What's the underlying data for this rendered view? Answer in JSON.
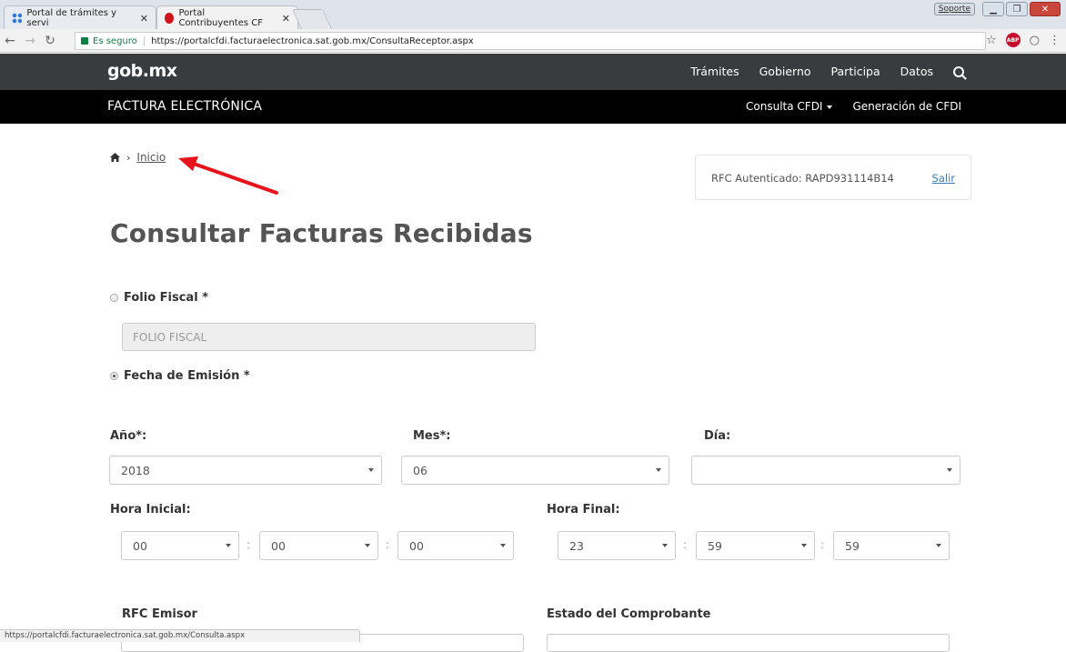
{
  "browser": {
    "tabs": [
      {
        "title": "Portal de trámites y servi",
        "active": false
      },
      {
        "title": "Portal Contribuyentes CF",
        "active": true
      }
    ],
    "window_button": "Soporte",
    "secure_label": "Es seguro",
    "url": "https://portalcfdi.facturaelectronica.sat.gob.mx/ConsultaReceptor.aspx",
    "status_url": "https://portalcfdi.facturaelectronica.sat.gob.mx/Consulta.aspx",
    "extension_badge": "ABP"
  },
  "header": {
    "logo": "gob.mx",
    "nav": [
      "Trámites",
      "Gobierno",
      "Participa",
      "Datos"
    ],
    "colors": {
      "top_bar": "#393c3e",
      "sub_bar": "#000000"
    }
  },
  "subheader": {
    "title": "FACTURA ELECTRÓNICA",
    "nav": [
      "Consulta CFDI",
      "Generación de CFDI"
    ]
  },
  "breadcrumb": {
    "link": "Inicio"
  },
  "session": {
    "rfc_label": "RFC Autenticado: RAPD931114B14",
    "logout": "Salir"
  },
  "main": {
    "title": "Consultar Facturas Recibidas",
    "folio": {
      "label": "Folio Fiscal *",
      "placeholder": "FOLIO FISCAL",
      "selected": false
    },
    "fecha": {
      "label": "Fecha de Emisión *",
      "selected": true
    },
    "anio": {
      "label": "Año*:",
      "value": "2018"
    },
    "mes": {
      "label": "Mes*:",
      "value": "06"
    },
    "dia": {
      "label": "Día:",
      "value": ""
    },
    "hora_inicial": {
      "label": "Hora Inicial:",
      "values": [
        "00",
        "00",
        "00"
      ]
    },
    "hora_final": {
      "label": "Hora Final:",
      "values": [
        "23",
        "59",
        "59"
      ]
    },
    "rfc_emisor": {
      "label": "RFC Emisor"
    },
    "estado": {
      "label": "Estado del Comprobante"
    },
    "time_separator": ":"
  },
  "annotation": {
    "arrow_color": "#e8141b"
  }
}
